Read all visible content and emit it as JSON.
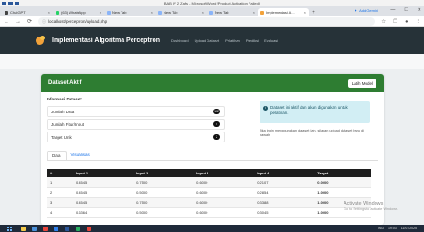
{
  "window": {
    "word_title": "BAB IV 2 Zaffs - Microsoft Word (Product Activation Failed)"
  },
  "browser": {
    "tabs": [
      {
        "label": "ChatGPT",
        "color": "#444444",
        "active": false
      },
      {
        "label": "(63) WhatsApp",
        "color": "#25d366",
        "active": false
      },
      {
        "label": "New Tab",
        "color": "#8ab4f8",
        "active": false
      },
      {
        "label": "New Tab",
        "color": "#8ab4f8",
        "active": false
      },
      {
        "label": "New Tab",
        "color": "#8ab4f8",
        "active": false
      },
      {
        "label": "Implementasi Al...",
        "color": "#f2a23a",
        "active": true
      }
    ],
    "tab_close": "×",
    "new_tab": "+",
    "account_label": "Add Gemini",
    "window_controls": [
      "—",
      "☐",
      "✕"
    ],
    "url": "localhost/perceptron/upload.php"
  },
  "app": {
    "brand": "Implementasi Algoritma Perceptron",
    "menu": [
      "Dashboard",
      "Upload Dataset",
      "Pelatihan",
      "Prediksi",
      "Evaluasi"
    ]
  },
  "card": {
    "title": "Dataset Aktif",
    "train_button": "Latih Model",
    "info_heading": "Informasi Dataset:",
    "rows": [
      {
        "label": "Jumlah Data",
        "value": "102"
      },
      {
        "label": "Jumlah Fitur/Input",
        "value": "4"
      },
      {
        "label": "Target Unik",
        "value": "2"
      }
    ],
    "alert_text": "Dataset ini aktif dan akan digunakan untuk pelatihan.",
    "hint_text": "Jika ingin menggunakan dataset lain, silakan upload dataset baru di bawah.",
    "tabs": [
      "Data",
      "Visualisasi"
    ],
    "table": {
      "headers": [
        "#",
        "Input 1",
        "Input 2",
        "Input 3",
        "Input 4",
        "Target"
      ],
      "rows": [
        [
          "1",
          "0.4545",
          "0.7500",
          "0.6000",
          "0.2107",
          "0.0000"
        ],
        [
          "2",
          "0.4545",
          "0.5000",
          "0.6000",
          "0.2854",
          "1.0000"
        ],
        [
          "3",
          "0.4545",
          "0.7500",
          "0.6000",
          "0.3388",
          "1.0000"
        ],
        [
          "4",
          "0.6364",
          "0.5000",
          "0.6000",
          "0.3045",
          "1.0000"
        ]
      ]
    }
  },
  "watermark": {
    "line1": "Activate Windows",
    "line2": "Go to Settings to activate Windows."
  },
  "taskbar": {
    "icon_colors": [
      "#f2c94c",
      "#4a90d9",
      "#e8453c",
      "#2f80ed",
      "#2b579a",
      "#27ae60",
      "#e8453c"
    ],
    "tray_text": "IND",
    "time": "19:03",
    "date": "11/07/2025"
  }
}
